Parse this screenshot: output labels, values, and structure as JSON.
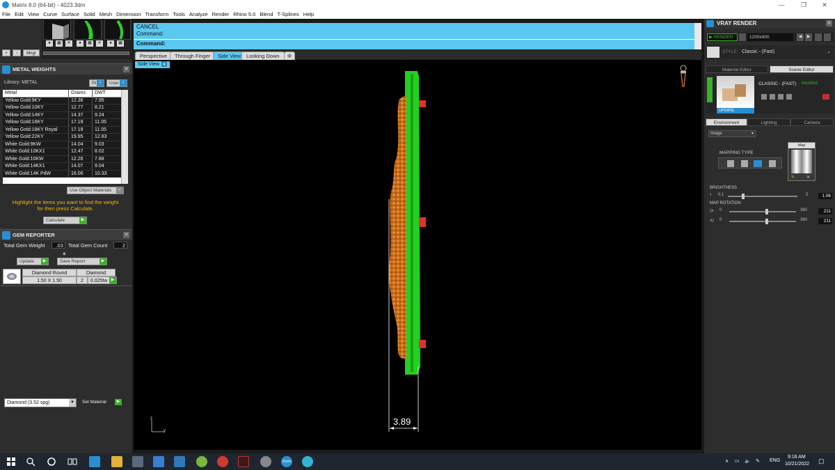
{
  "window": {
    "title": "Matrix 8.0 (64-bit) - 4023.3dm",
    "min_glyph": "—",
    "max_glyph": "❐",
    "close_glyph": "✕"
  },
  "menu": [
    "File",
    "Edit",
    "View",
    "Curve",
    "Surface",
    "Solid",
    "Mesh",
    "Dimension",
    "Transform",
    "Tools",
    "Analyze",
    "Render",
    "Rhino 5.0",
    "Blend",
    "T-Splines",
    "Help"
  ],
  "left": {
    "toolbar": {
      "add_glyph": "+",
      "up_glyph": "↑",
      "mngr_label": "Mngr"
    },
    "metal_weights": {
      "title": "METAL WEIGHTS",
      "library_label": "Library: METAL",
      "lib_btn_a": "RI",
      "lib_btn_b": "User",
      "headers": [
        "Metal",
        "Grams",
        "DWT"
      ],
      "rows": [
        [
          "Yellow Gold:9KY",
          "12.36",
          "7.95"
        ],
        [
          "Yellow Gold:10KY",
          "12.77",
          "8.21"
        ],
        [
          "Yellow Gold:14KY",
          "14.37",
          "9.24"
        ],
        [
          "Yellow Gold:18KY",
          "17.19",
          "11.05"
        ],
        [
          "Yellow Gold:18KY Royal",
          "17.19",
          "11.05"
        ],
        [
          "Yellow Gold:22KY",
          "19.95",
          "12.83"
        ],
        [
          "White Gold:9KW",
          "14.04",
          "9.03"
        ],
        [
          "White Gold:10KX1",
          "12.47",
          "8.02"
        ],
        [
          "White Gold:10KW",
          "12.26",
          "7.88"
        ],
        [
          "White Gold:14KX1",
          "14.07",
          "9.04"
        ],
        [
          "White Gold:14K PdW",
          "16.06",
          "10.33"
        ]
      ],
      "use_object_materials": "Use Object Materials",
      "hint_line1": "Highlight the items you want to find the weight",
      "hint_line2": "for then press Calculate.",
      "calculate": "Calculate"
    },
    "gem_reporter": {
      "title": "GEM REPORTER",
      "total_weight_label": "Total Gem Weight",
      "total_weight_value": ".03",
      "total_count_label": "Total Gem Count",
      "total_count_value": "2",
      "update": "Update",
      "save_report": "Save Report",
      "gem": {
        "shape": "Diamond Round",
        "material": "Diamond",
        "size": "1.50 X 1.50",
        "count": "2",
        "weight": "0.025tw"
      }
    },
    "material_select": "Diamond    (3.52 spg)",
    "set_material": "Set Material"
  },
  "command": {
    "line1": "CANCEL",
    "line2": "Command:",
    "prompt": "Command:"
  },
  "viewport_tabs": [
    "Perspective",
    "Through Finger",
    "Side View",
    "Looking Down"
  ],
  "active_tab_index": 2,
  "add_tab_glyph": "✣",
  "viewport": {
    "label": "Side View",
    "dimension": "3.89",
    "axis_up": "z",
    "axis_right": "y"
  },
  "right": {
    "title": "VRAY RENDER",
    "render_btn": "RENDER",
    "resolution": "1200x900",
    "style_label": "STYLE:",
    "style_value": "Classic - (Fast)",
    "tabs_top": [
      "Material Editor",
      "Scene Editor"
    ],
    "active_top": 1,
    "preset_name": "CLASSIC - (FAST)",
    "preset_status": "Modified",
    "update": "UPDATE",
    "tabs_env": [
      "Environment",
      "Lighting",
      "Camera"
    ],
    "active_env": 0,
    "env_type": "Image",
    "mapping_type": "MAPPING TYPE",
    "map_label": "Map",
    "brightness_label": "BRIGHTNESS",
    "brightness": {
      "lo": "0.1",
      "hi": "5",
      "value": "1.06"
    },
    "map_rotation_label": "MAP ROTATION",
    "rot1": {
      "lo": "0",
      "hi": "360",
      "value": "211"
    },
    "rot2": {
      "lo": "0",
      "hi": "360",
      "value": "211"
    }
  },
  "taskbar": {
    "lang": "ENG",
    "time": "9:16 AM",
    "date": "10/21/2022",
    "zoom_label": "Zoom"
  }
}
